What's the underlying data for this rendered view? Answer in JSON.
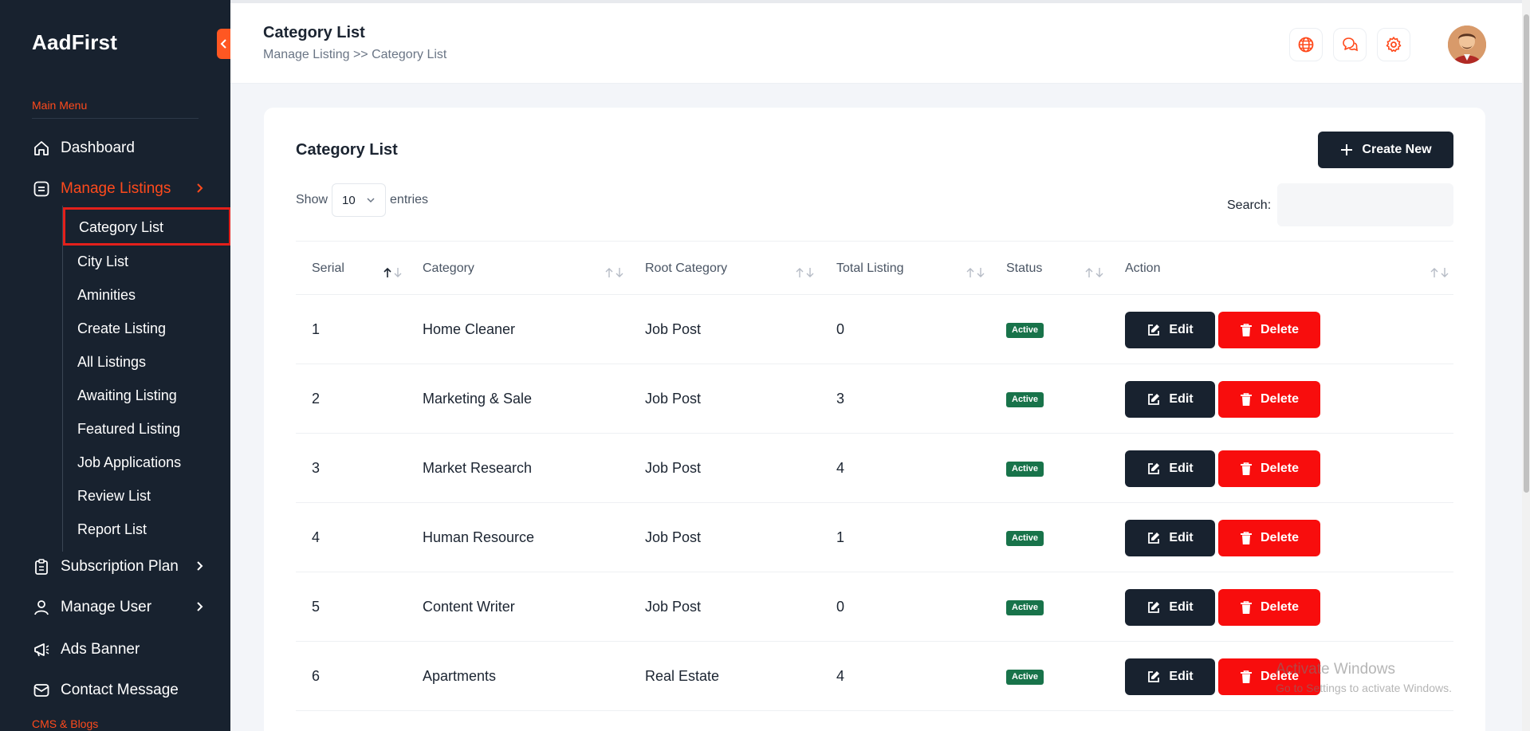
{
  "sidebar": {
    "brand": "AadFirst",
    "main_menu_label": "Main Menu",
    "cms_label": "CMS & Blogs",
    "items": [
      {
        "label": "Dashboard",
        "icon": "home-icon"
      },
      {
        "label": "Manage Listings",
        "icon": "list-icon",
        "active": true
      },
      {
        "label": "Subscription Plan",
        "icon": "clipboard-icon"
      },
      {
        "label": "Manage User",
        "icon": "user-icon"
      },
      {
        "label": "Ads Banner",
        "icon": "megaphone-icon"
      },
      {
        "label": "Contact Message",
        "icon": "mail-icon"
      }
    ],
    "sub_items": [
      "Category List",
      "City List",
      "Aminities",
      "Create Listing",
      "All Listings",
      "Awaiting Listing",
      "Featured Listing",
      "Job Applications",
      "Review List",
      "Report List"
    ]
  },
  "header": {
    "title": "Category List",
    "breadcrumb": "Manage Listing >> Category List",
    "icons": [
      "globe-icon",
      "chat-icon",
      "gear-icon"
    ]
  },
  "card": {
    "title": "Category List",
    "create_label": "Create New",
    "show_label": "Show",
    "entries_value": "10",
    "entries_label": "entries",
    "search_label": "Search:",
    "search_value": ""
  },
  "table": {
    "columns": [
      "Serial",
      "Category",
      "Root Category",
      "Total Listing",
      "Status",
      "Action"
    ],
    "rows": [
      {
        "serial": "1",
        "category": "Home Cleaner",
        "root": "Job Post",
        "total": "0",
        "status": "Active"
      },
      {
        "serial": "2",
        "category": "Marketing & Sale",
        "root": "Job Post",
        "total": "3",
        "status": "Active"
      },
      {
        "serial": "3",
        "category": "Market Research",
        "root": "Job Post",
        "total": "4",
        "status": "Active"
      },
      {
        "serial": "4",
        "category": "Human Resource",
        "root": "Job Post",
        "total": "1",
        "status": "Active"
      },
      {
        "serial": "5",
        "category": "Content Writer",
        "root": "Job Post",
        "total": "0",
        "status": "Active"
      },
      {
        "serial": "6",
        "category": "Apartments",
        "root": "Real Estate",
        "total": "4",
        "status": "Active"
      }
    ],
    "edit_label": "Edit",
    "delete_label": "Delete"
  },
  "watermark": {
    "line1": "Activate Windows",
    "line2": "Go to Settings to activate Windows."
  },
  "colors": {
    "sidebar_bg": "#18222f",
    "accent": "#ff4a1c",
    "status_active": "#18734a",
    "delete": "#f80d0d"
  }
}
